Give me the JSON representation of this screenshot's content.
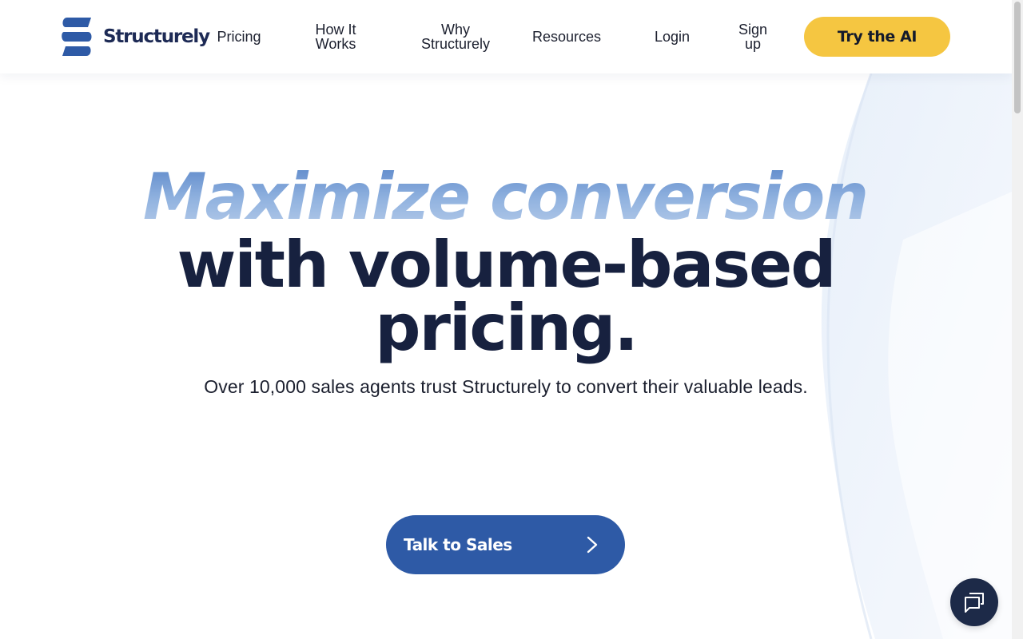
{
  "brand": {
    "name": "Structurely",
    "logo_icon": "structurely-s-logo",
    "colors": {
      "primary": "#2e5aa6",
      "dark": "#17213f",
      "accent": "#f5c641"
    }
  },
  "nav": {
    "items": [
      {
        "label": "Pricing"
      },
      {
        "label_line1": "How It",
        "label_line2": "Works"
      },
      {
        "label_line1": "Why",
        "label_line2": "Structurely"
      },
      {
        "label": "Resources"
      },
      {
        "label": "Login"
      },
      {
        "label_line1": "Sign",
        "label_line2": "up"
      }
    ],
    "cta_label": "Try the AI"
  },
  "hero": {
    "headline_line1": "Maximize conversion",
    "headline_line2": "with volume-based",
    "headline_line3": "pricing.",
    "subheadline": "Over 10,000 sales agents trust Structurely to convert their valuable leads.",
    "cta_label": "Talk to Sales",
    "cta_icon": "chevron-right-icon"
  },
  "chat_widget": {
    "icon": "chat-bubbles-icon"
  }
}
